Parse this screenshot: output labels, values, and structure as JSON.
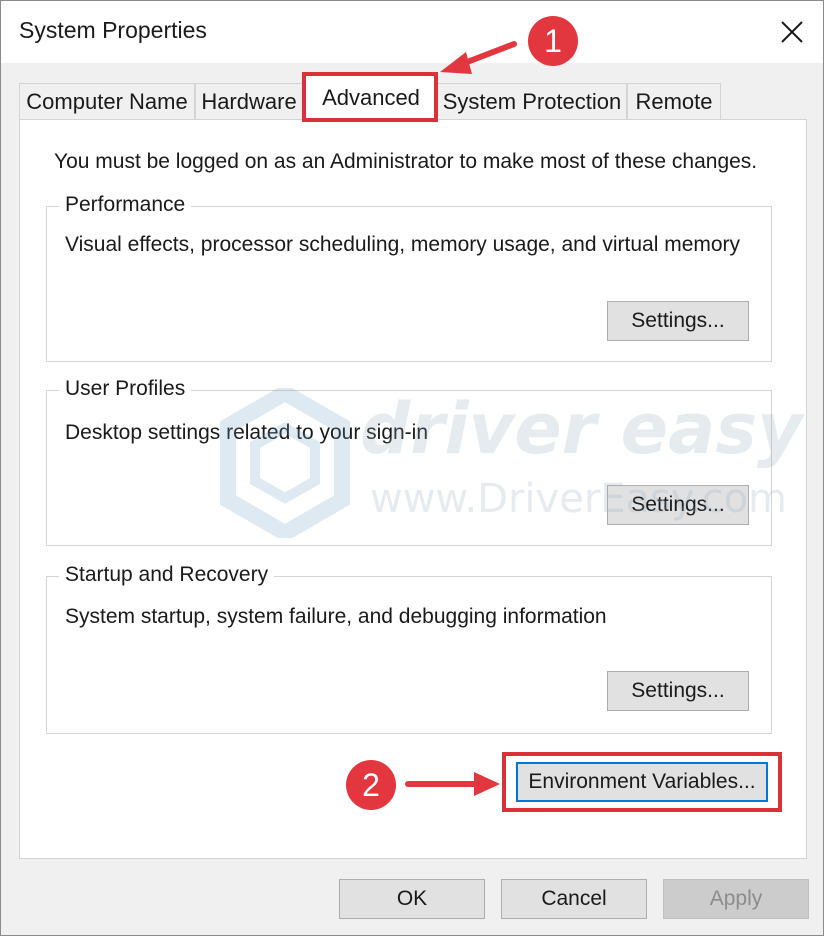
{
  "window": {
    "title": "System Properties",
    "close_icon": "close-icon"
  },
  "tabs": [
    {
      "label": "Computer Name",
      "active": false
    },
    {
      "label": "Hardware",
      "active": false
    },
    {
      "label": "Advanced",
      "active": true
    },
    {
      "label": "System Protection",
      "active": false
    },
    {
      "label": "Remote",
      "active": false
    }
  ],
  "advanced": {
    "admin_note": "You must be logged on as an Administrator to make most of these changes.",
    "groups": [
      {
        "title": "Performance",
        "description": "Visual effects, processor scheduling, memory usage, and virtual memory",
        "button": "Settings..."
      },
      {
        "title": "User Profiles",
        "description": "Desktop settings related to your sign-in",
        "button": "Settings..."
      },
      {
        "title": "Startup and Recovery",
        "description": "System startup, system failure, and debugging information",
        "button": "Settings..."
      }
    ],
    "env_button": "Environment Variables..."
  },
  "footer": {
    "ok": "OK",
    "cancel": "Cancel",
    "apply": "Apply"
  },
  "annotations": {
    "step1": "1",
    "step2": "2",
    "color": "#e2373f"
  },
  "watermark": {
    "brand": "driver easy",
    "url": "www.DriverEasy.com"
  }
}
